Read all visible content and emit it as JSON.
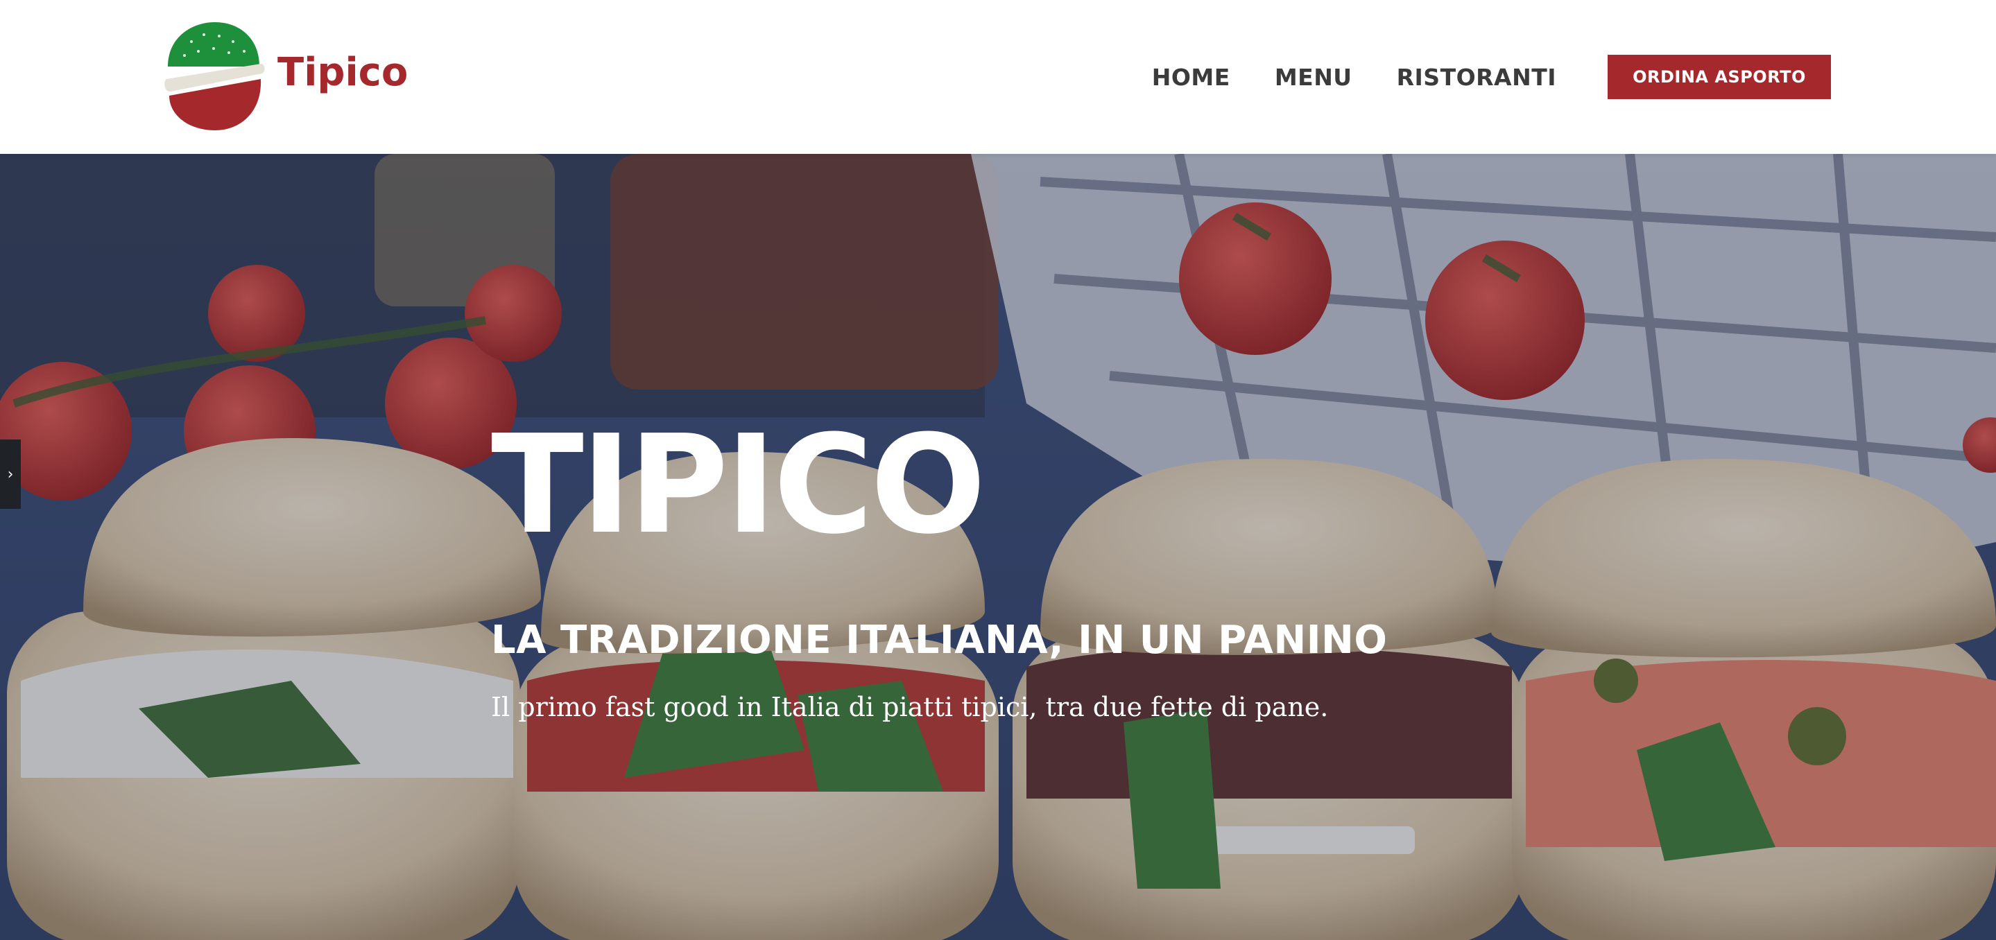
{
  "brand": {
    "name": "Tipico",
    "colors": {
      "green": "#1e8f3a",
      "cream": "#e6e1d6",
      "red": "#a5282d"
    }
  },
  "nav": {
    "items": [
      {
        "label": "HOME"
      },
      {
        "label": "MENU"
      },
      {
        "label": "RISTORANTI"
      }
    ],
    "cta_label": "ORDINA ASPORTO"
  },
  "hero": {
    "title": "TIPICO",
    "subtitle": "LA TRADIZIONE ITALIANA, IN UN PANINO",
    "tagline": "Il primo fast good in Italia di piatti tipici, tra due fette di pane.",
    "side_tab_icon": "chevron-right-icon"
  }
}
